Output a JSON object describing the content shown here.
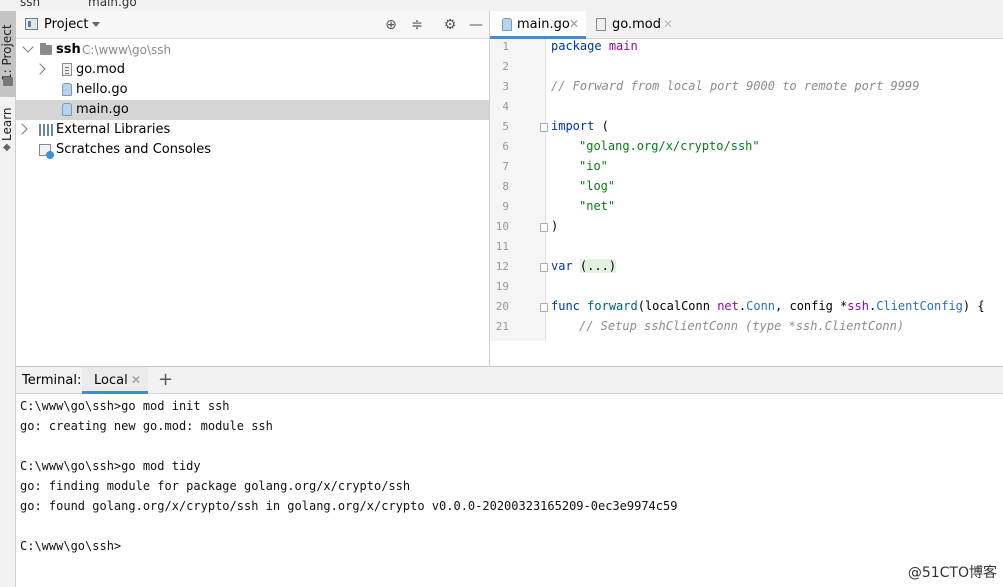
{
  "breadcrumb": {
    "items": [
      "ssh",
      "main.go"
    ]
  },
  "left_toolbar": {
    "project_tab": "1: Project",
    "learn_tab": "Learn"
  },
  "project_panel": {
    "title": "Project",
    "tree": [
      {
        "label": "ssh",
        "path": "C:\\www\\go\\ssh"
      },
      {
        "label": "go.mod"
      },
      {
        "label": "hello.go"
      },
      {
        "label": "main.go"
      },
      {
        "label": "External Libraries"
      },
      {
        "label": "Scratches and Consoles"
      }
    ]
  },
  "editor": {
    "tabs": [
      {
        "label": "main.go",
        "active": true
      },
      {
        "label": "go.mod",
        "active": false
      }
    ],
    "line_numbers": [
      "1",
      "2",
      "3",
      "4",
      "5",
      "6",
      "7",
      "8",
      "9",
      "10",
      "11",
      "12",
      "19",
      "20",
      "21"
    ],
    "code": {
      "l1_kw": "package",
      "l1_name": "main",
      "l3": "// Forward from local port 9000 to remote port 9999",
      "l5_kw": "import",
      "l5_rest": " (",
      "l6": "\"golang.org/x/crypto/ssh\"",
      "l7": "\"io\"",
      "l8": "\"log\"",
      "l9": "\"net\"",
      "l10": ")",
      "l12_kw": "var",
      "l12_rest": "(...)",
      "l20_kw": "func",
      "l20_fn": "forward",
      "l20_a": "(localConn ",
      "l20_pk1": "net",
      "l20_b": ".",
      "l20_ty1": "Conn",
      "l20_c": ", config *",
      "l20_pk2": "ssh",
      "l20_d": ".",
      "l20_ty2": "ClientConfig",
      "l20_e": ") {",
      "l21": "// Setup sshClientConn (type *ssh.ClientConn)"
    }
  },
  "terminal": {
    "label": "Terminal:",
    "tab": "Local",
    "lines": [
      "C:\\www\\go\\ssh>go mod init ssh",
      "go: creating new go.mod: module ssh",
      "",
      "C:\\www\\go\\ssh>go mod tidy",
      "go: finding module for package golang.org/x/crypto/ssh",
      "go: found golang.org/x/crypto/ssh in golang.org/x/crypto v0.0.0-20200323165209-0ec3e9974c59",
      "",
      "C:\\www\\go\\ssh>"
    ]
  },
  "watermark": "@51CTO博客",
  "colors": {
    "accent": "#4a88c7",
    "selection": "#d5d5d5",
    "keyword": "#0033b3",
    "string": "#067d17",
    "comment": "#8c8c8c"
  },
  "icons": [
    "project-icon",
    "target-icon",
    "collapse-icon",
    "gear-icon",
    "minimize-icon",
    "folder-icon",
    "go-file-icon",
    "mod-file-icon",
    "library-icon",
    "scratches-icon",
    "plus-icon",
    "close-icon"
  ]
}
